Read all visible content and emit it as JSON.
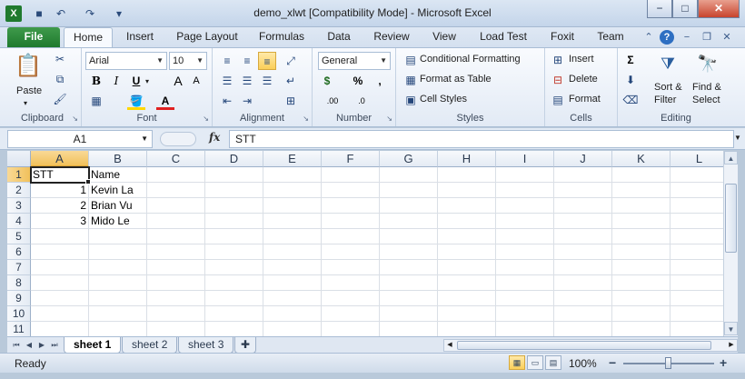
{
  "window": {
    "title": "demo_xlwt  [Compatibility Mode]  -  Microsoft Excel",
    "app_icon": "excel-icon",
    "controls": {
      "minimize": "−",
      "maximize": "□",
      "close": "✕"
    }
  },
  "quick_access": {
    "save": "💾",
    "undo": "↶",
    "redo": "↷",
    "customize": "▾"
  },
  "tabs": [
    {
      "label": "File"
    },
    {
      "label": "Home"
    },
    {
      "label": "Insert"
    },
    {
      "label": "Page Layout"
    },
    {
      "label": "Formulas"
    },
    {
      "label": "Data"
    },
    {
      "label": "Review"
    },
    {
      "label": "View"
    },
    {
      "label": "Load Test"
    },
    {
      "label": "Foxit"
    },
    {
      "label": "Team"
    }
  ],
  "ribbon": {
    "clipboard": {
      "label": "Clipboard",
      "paste": "Paste"
    },
    "font": {
      "label": "Font",
      "font_name": "Arial",
      "font_size": "10",
      "bold": "B",
      "italic": "I",
      "underline": "U",
      "grow": "A",
      "shrink": "A",
      "color_letter": "A"
    },
    "alignment": {
      "label": "Alignment"
    },
    "number": {
      "label": "Number",
      "format": "General",
      "currency": "$",
      "percent": "%",
      "comma": ",",
      "inc_decimal": ".00",
      "dec_decimal": ".0"
    },
    "styles": {
      "label": "Styles",
      "conditional": "Conditional Formatting",
      "format_table": "Format as Table",
      "cell_styles": "Cell Styles"
    },
    "cells": {
      "label": "Cells",
      "insert": "Insert",
      "delete": "Delete",
      "format": "Format"
    },
    "editing": {
      "label": "Editing",
      "sigma": "Σ",
      "sort_filter_1": "Sort &",
      "sort_filter_2": "Filter",
      "find_select_1": "Find &",
      "find_select_2": "Select"
    }
  },
  "formula_bar": {
    "name_box": "A1",
    "fx": "fx",
    "value": "STT"
  },
  "grid": {
    "columns": [
      "A",
      "B",
      "C",
      "D",
      "E",
      "F",
      "G",
      "H",
      "I",
      "J",
      "K",
      "L"
    ],
    "rows": [
      "1",
      "2",
      "3",
      "4",
      "5",
      "6",
      "7",
      "8",
      "9",
      "10",
      "11"
    ],
    "cells": [
      [
        "STT",
        "Name"
      ],
      [
        "1",
        "Kevin La"
      ],
      [
        "2",
        "Brian Vu"
      ],
      [
        "3",
        "Mido Le"
      ]
    ],
    "active_cell": "A1"
  },
  "sheets": [
    {
      "label": "sheet 1",
      "active": true
    },
    {
      "label": "sheet 2",
      "active": false
    },
    {
      "label": "sheet 3",
      "active": false
    }
  ],
  "status": {
    "ready": "Ready",
    "zoom": "100%",
    "zoom_level": 0.5,
    "minus": "−",
    "plus": "+"
  }
}
